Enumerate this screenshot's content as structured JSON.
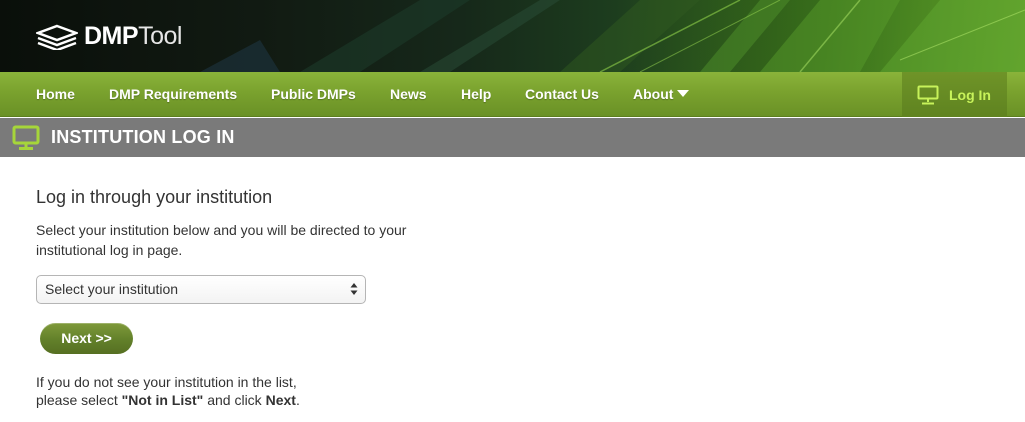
{
  "header": {
    "logo_bold": "DMP",
    "logo_light": "Tool"
  },
  "nav": {
    "items": [
      {
        "label": "Home"
      },
      {
        "label": "DMP Requirements"
      },
      {
        "label": "Public DMPs"
      },
      {
        "label": "News"
      },
      {
        "label": "Help"
      },
      {
        "label": "Contact Us"
      },
      {
        "label": "About"
      }
    ],
    "login_label": "Log In",
    "login_icon": "monitor-icon"
  },
  "page": {
    "title": "INSTITUTION LOG IN",
    "title_icon": "monitor-icon"
  },
  "main": {
    "heading": "Log in through your institution",
    "description": "Select your institution below and you will be directed to your institutional log in page.",
    "select": {
      "value": "Select your institution"
    },
    "next_label": "Next >>",
    "note_line1": "If you do not see your institution in the list,",
    "note_pre": "please select ",
    "note_bold1": "\"Not in List\"",
    "note_mid": " and click ",
    "note_bold2": "Next",
    "note_end": "."
  },
  "colors": {
    "nav_green": "#7aa22e",
    "login_accent": "#c7f25a",
    "title_bar": "#7a7a7a",
    "button_green": "#62802a"
  }
}
